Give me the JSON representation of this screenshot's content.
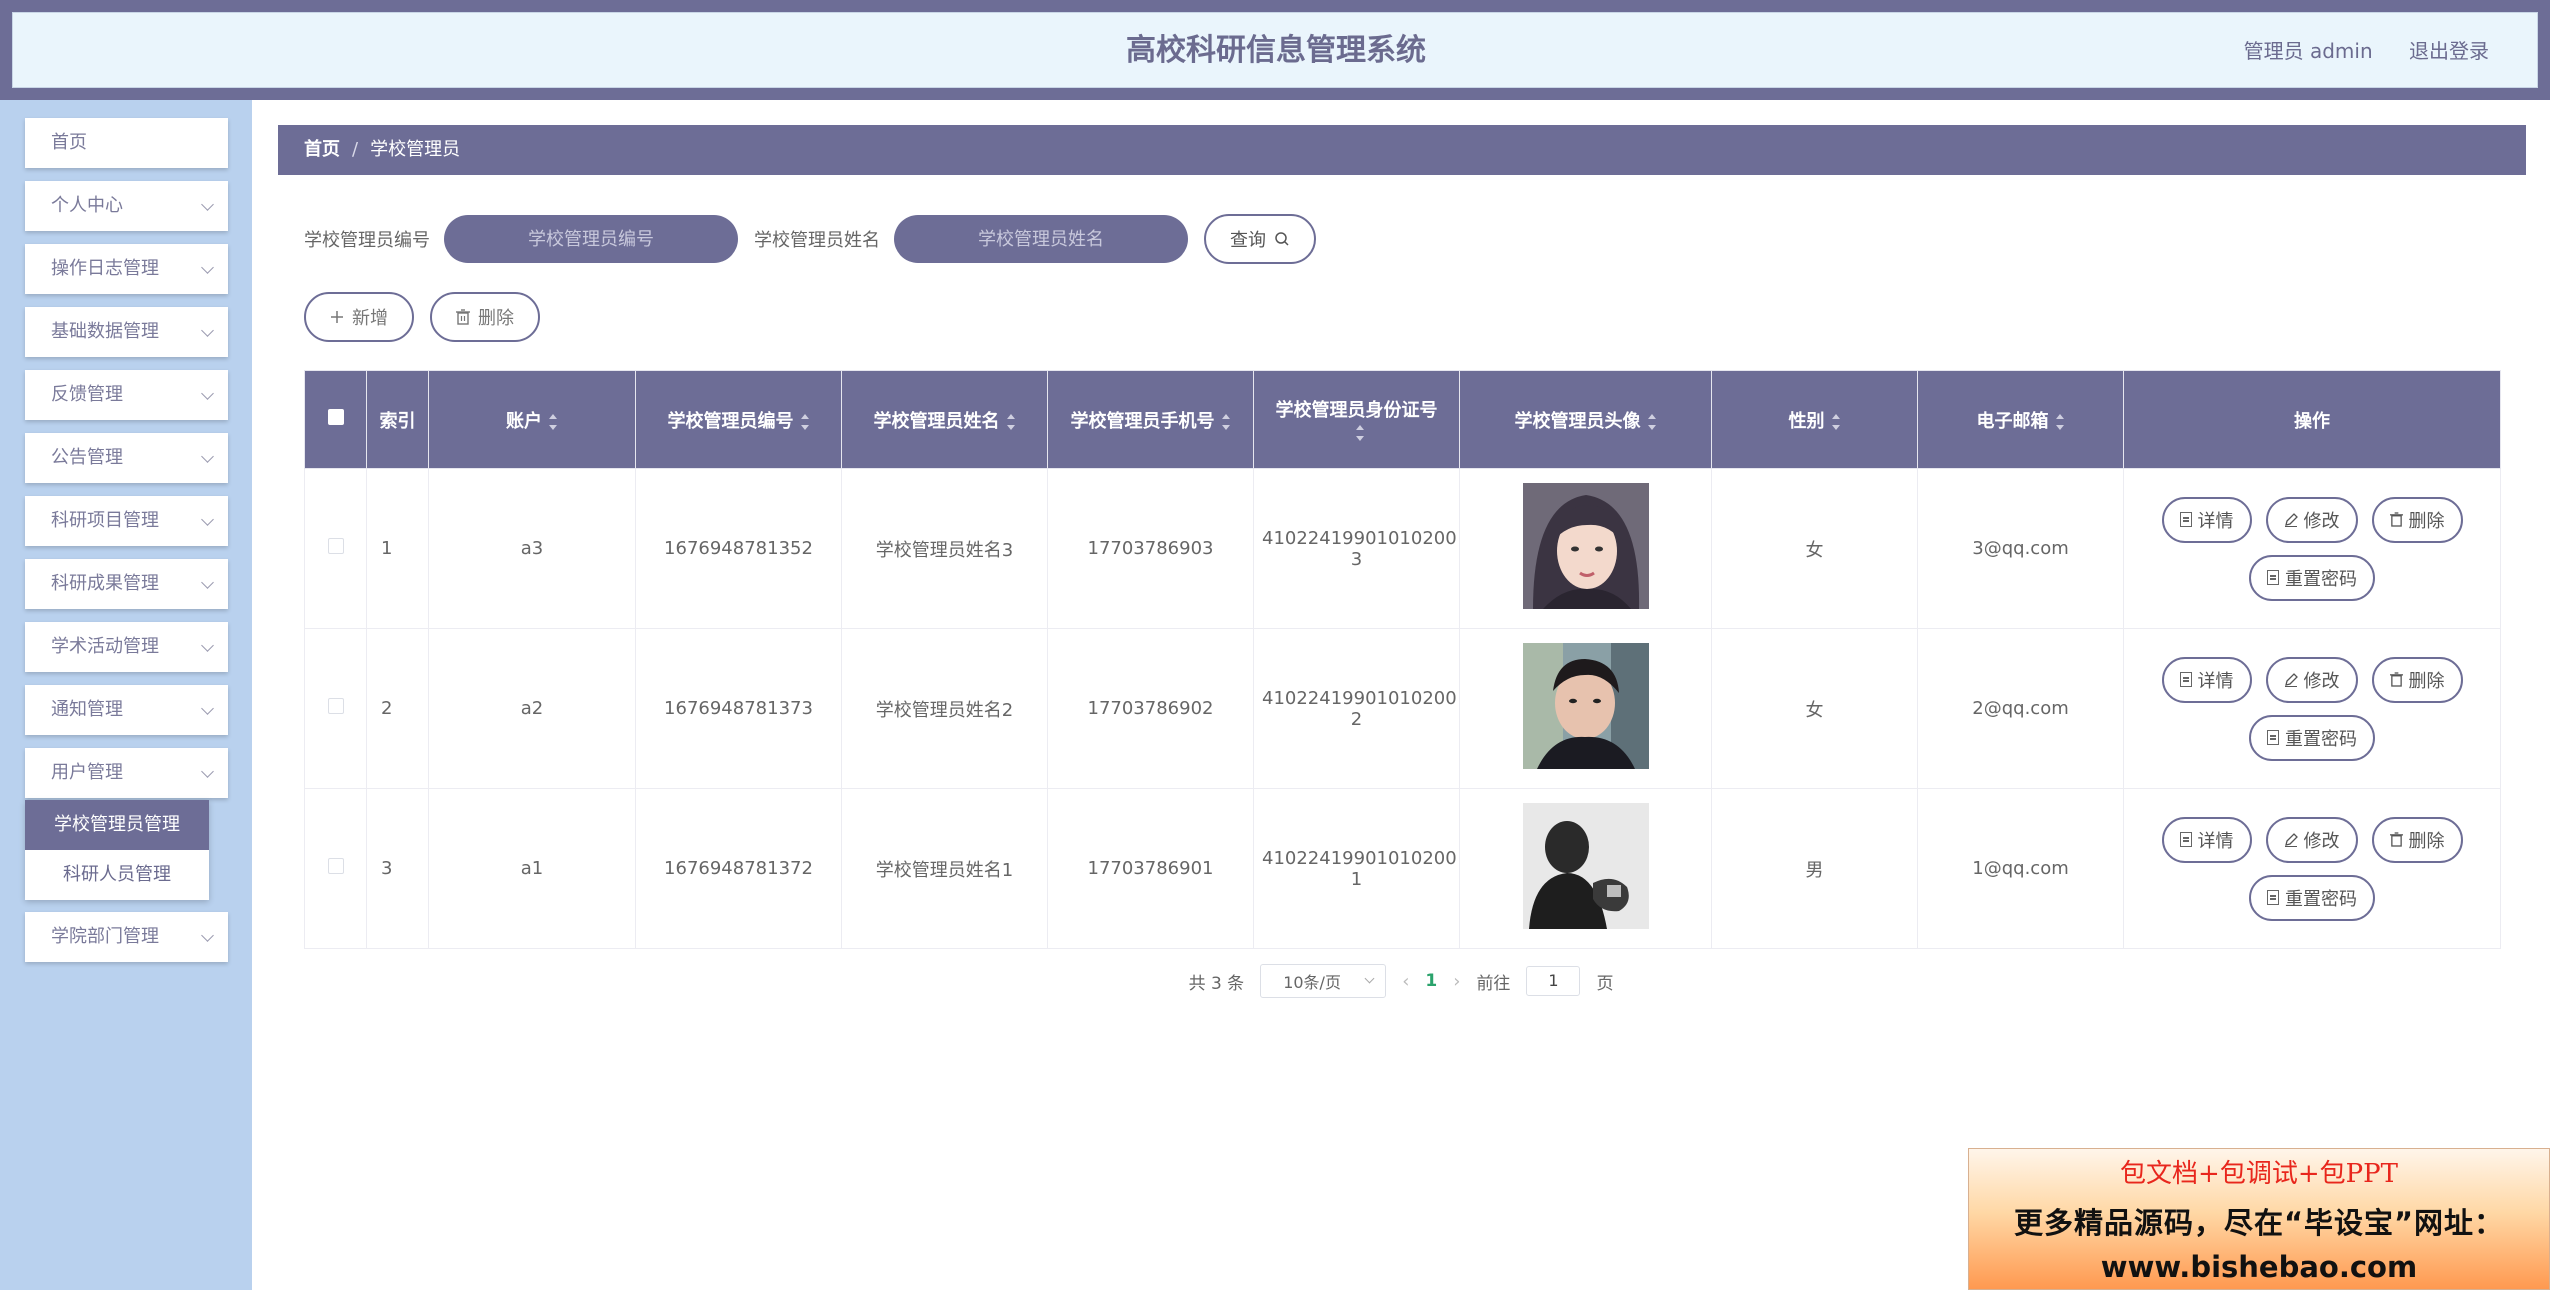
{
  "header": {
    "title": "高校科研信息管理系统",
    "user_label": "管理员 admin",
    "logout_label": "退出登录"
  },
  "sidebar": {
    "items": [
      {
        "label": "首页",
        "has_children": false
      },
      {
        "label": "个人中心",
        "has_children": true
      },
      {
        "label": "操作日志管理",
        "has_children": true
      },
      {
        "label": "基础数据管理",
        "has_children": true
      },
      {
        "label": "反馈管理",
        "has_children": true
      },
      {
        "label": "公告管理",
        "has_children": true
      },
      {
        "label": "科研项目管理",
        "has_children": true
      },
      {
        "label": "科研成果管理",
        "has_children": true
      },
      {
        "label": "学术活动管理",
        "has_children": true
      },
      {
        "label": "通知管理",
        "has_children": true
      },
      {
        "label": "用户管理",
        "has_children": true
      },
      {
        "label": "学院部门管理",
        "has_children": true
      }
    ],
    "submenu": [
      {
        "label": "学校管理员管理",
        "active": true
      },
      {
        "label": "科研人员管理",
        "active": false
      }
    ]
  },
  "breadcrumb": {
    "home": "首页",
    "sep": "/",
    "current": "学校管理员"
  },
  "search": {
    "field1_label": "学校管理员编号",
    "field1_placeholder": "学校管理员编号",
    "field2_label": "学校管理员姓名",
    "field2_placeholder": "学校管理员姓名",
    "query_label": "查询"
  },
  "actions": {
    "add_label": "新增",
    "delete_label": "删除"
  },
  "table": {
    "headers": [
      "索引",
      "账户",
      "学校管理员编号",
      "学校管理员姓名",
      "学校管理员手机号",
      "学校管理员身份证号",
      "学校管理员头像",
      "性别",
      "电子邮箱",
      "操作"
    ],
    "rows": [
      {
        "index": "1",
        "account": "a3",
        "code": "1676948781352",
        "name": "学校管理员姓名3",
        "phone": "17703786903",
        "idcard_line1": "41022419901010200",
        "idcard_line2": "3",
        "gender": "女",
        "email": "3@qq.com"
      },
      {
        "index": "2",
        "account": "a2",
        "code": "1676948781373",
        "name": "学校管理员姓名2",
        "phone": "17703786902",
        "idcard_line1": "41022419901010200",
        "idcard_line2": "2",
        "gender": "女",
        "email": "2@qq.com"
      },
      {
        "index": "3",
        "account": "a1",
        "code": "1676948781372",
        "name": "学校管理员姓名1",
        "phone": "17703786901",
        "idcard_line1": "41022419901010200",
        "idcard_line2": "1",
        "gender": "男",
        "email": "1@qq.com"
      }
    ],
    "row_actions": {
      "detail": "详情",
      "edit": "修改",
      "delete": "删除",
      "reset": "重置密码"
    }
  },
  "pagination": {
    "total_text": "共 3 条",
    "page_size": "10条/页",
    "current_page": "1",
    "goto_prefix": "前往",
    "goto_value": "1",
    "goto_suffix": "页"
  },
  "ad": {
    "line1": "包文档+包调试+包PPT",
    "line2": "更多精品源码，尽在“毕设宝”网址：",
    "line3": "www.bishebao.com"
  },
  "colors": {
    "primary": "#6d6d96",
    "sidebar_bg": "#b9d1ee",
    "header_bg": "#eaf5fc",
    "pager_active": "#2ba36c"
  }
}
